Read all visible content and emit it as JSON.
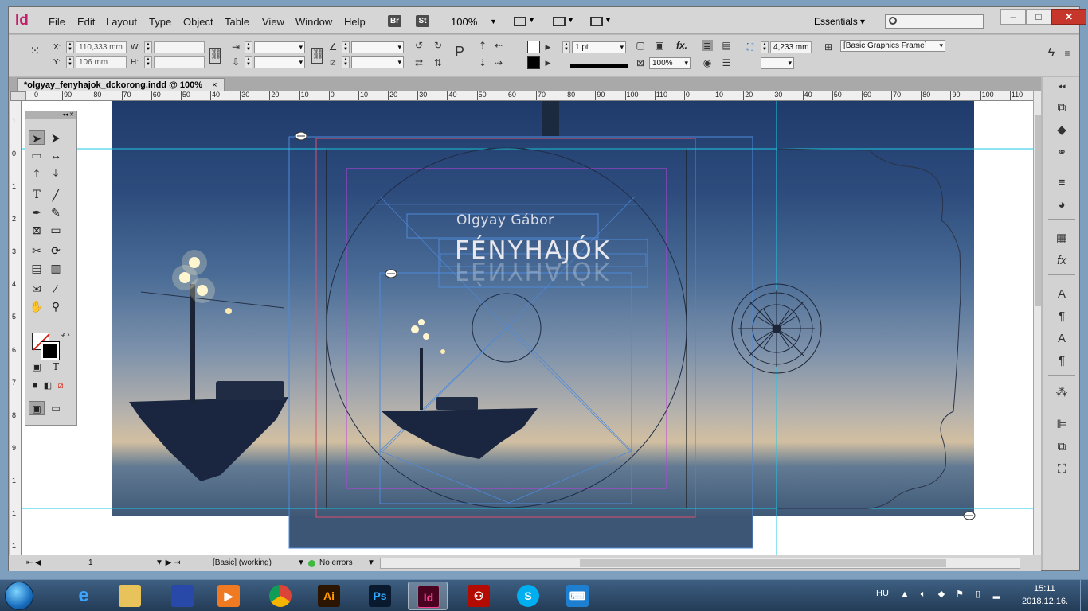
{
  "app": {
    "logo": "Id",
    "menus": [
      "File",
      "Edit",
      "Layout",
      "Type",
      "Object",
      "Table",
      "View",
      "Window",
      "Help"
    ],
    "badges": [
      "Br",
      "St"
    ],
    "zoom": "100%",
    "workspace": "Essentials",
    "search_placeholder": ""
  },
  "control_panel": {
    "x_label": "X:",
    "x_value": "110,333 mm",
    "y_label": "Y:",
    "y_value": "106 mm",
    "w_label": "W:",
    "h_label": "H:",
    "stroke_weight": "1 pt",
    "opacity": "100%",
    "fx_label": "fx.",
    "offset_value": "4,233 mm",
    "object_style": "[Basic Graphics Frame]"
  },
  "document": {
    "tab_title": "*olgyay_fenyhajok_dckorong.indd @ 100%",
    "close_symbol": "×",
    "author_text": "Olgyay Gábor",
    "title_text": "FÉNYHAJÓK"
  },
  "ruler": {
    "h_labels": [
      "0",
      "90",
      "80",
      "70",
      "60",
      "50",
      "40",
      "30",
      "20",
      "10",
      "0",
      "10",
      "20",
      "30",
      "40",
      "50",
      "60",
      "70",
      "80",
      "90",
      "100",
      "110",
      "0",
      "10",
      "20",
      "30",
      "40",
      "50",
      "60",
      "70",
      "80",
      "90",
      "100",
      "110"
    ],
    "v_labels": [
      "1",
      "0",
      "1",
      "2",
      "3",
      "4",
      "5",
      "6",
      "7",
      "8",
      "9",
      "1",
      "1",
      "1"
    ]
  },
  "statusbar": {
    "page": "1",
    "style": "[Basic] (working)",
    "preflight": "No errors"
  },
  "taskbar": {
    "language": "HU",
    "time": "15:11",
    "date": "2018.12.16."
  },
  "colors": {
    "indesign_brand": "#c21e6b",
    "guide_cyan": "#1ec8e6",
    "bleed_red": "#e0506e",
    "margin_magenta": "#c040e0",
    "frame_blue": "#4f8ad8"
  }
}
